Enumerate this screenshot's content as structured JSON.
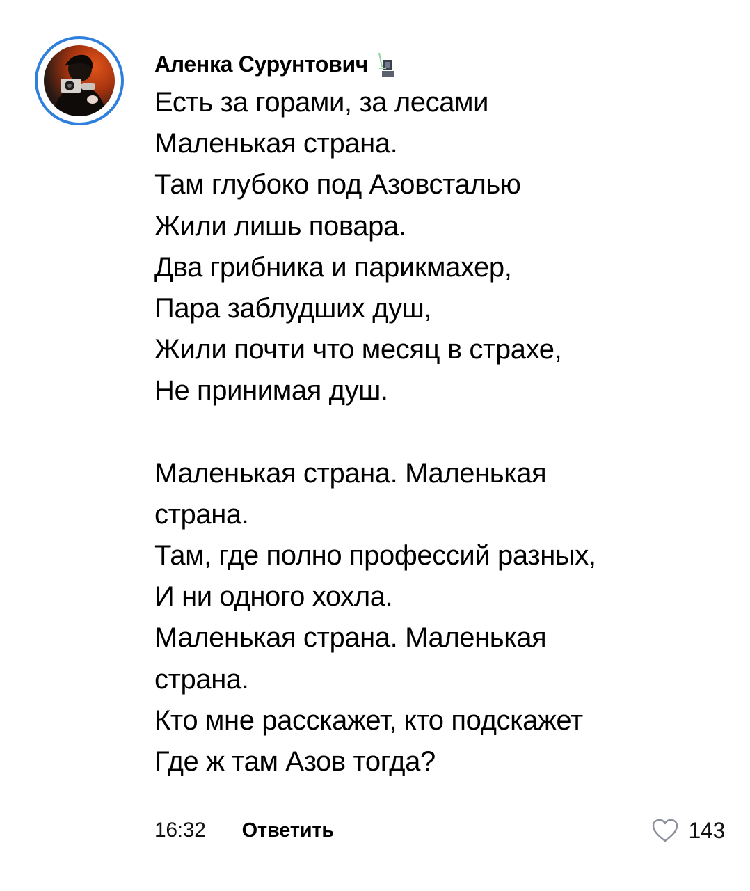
{
  "comment": {
    "author": "Аленка Сурунтович",
    "text_lines": [
      "Есть за горами, за лесами",
      "Маленькая страна.",
      "Там глубоко под Азовсталью",
      "Жили лишь повара.",
      "Два грибника и парикмахер,",
      "Пара заблудших душ,",
      "Жили почти что месяц в страхе,",
      "Не принимая душ.",
      "",
      "Маленькая страна. Маленькая",
      "страна.",
      "Там, где полно профессий разных,",
      "И ни одного хохла.",
      "Маленькая страна. Маленькая",
      "страна.",
      "Кто мне расскажет, кто подскажет",
      "Где ж там Азов тогда?"
    ],
    "time": "16:32",
    "reply_label": "Ответить",
    "like_count": "143"
  },
  "icons": {
    "avatar": "user-avatar-photo",
    "badge": "author-badge-icon",
    "like": "heart-outline-icon"
  },
  "colors": {
    "avatar_ring": "#2f7fdc",
    "text": "#000000",
    "background": "#ffffff"
  }
}
